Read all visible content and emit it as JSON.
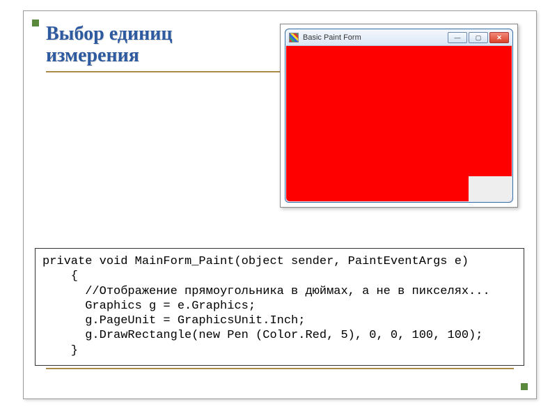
{
  "slide": {
    "title_line1": "Выбор единиц",
    "title_line2": "измерения"
  },
  "window": {
    "title": "Basic Paint Form",
    "btn_min": "—",
    "btn_max": "▢",
    "btn_close": "✕"
  },
  "code": {
    "line1": "private void MainForm_Paint(object sender, PaintEventArgs e)",
    "line2": "    {",
    "line3": "      //Отображение прямоугольника в дюймах, а не в пикселях...",
    "line4": "      Graphics g = e.Graphics;",
    "line5": "      g.PageUnit = GraphicsUnit.Inch;",
    "line6": "      g.DrawRectangle(new Pen (Color.Red, 5), 0, 0, 100, 100);",
    "line7": "    }"
  }
}
